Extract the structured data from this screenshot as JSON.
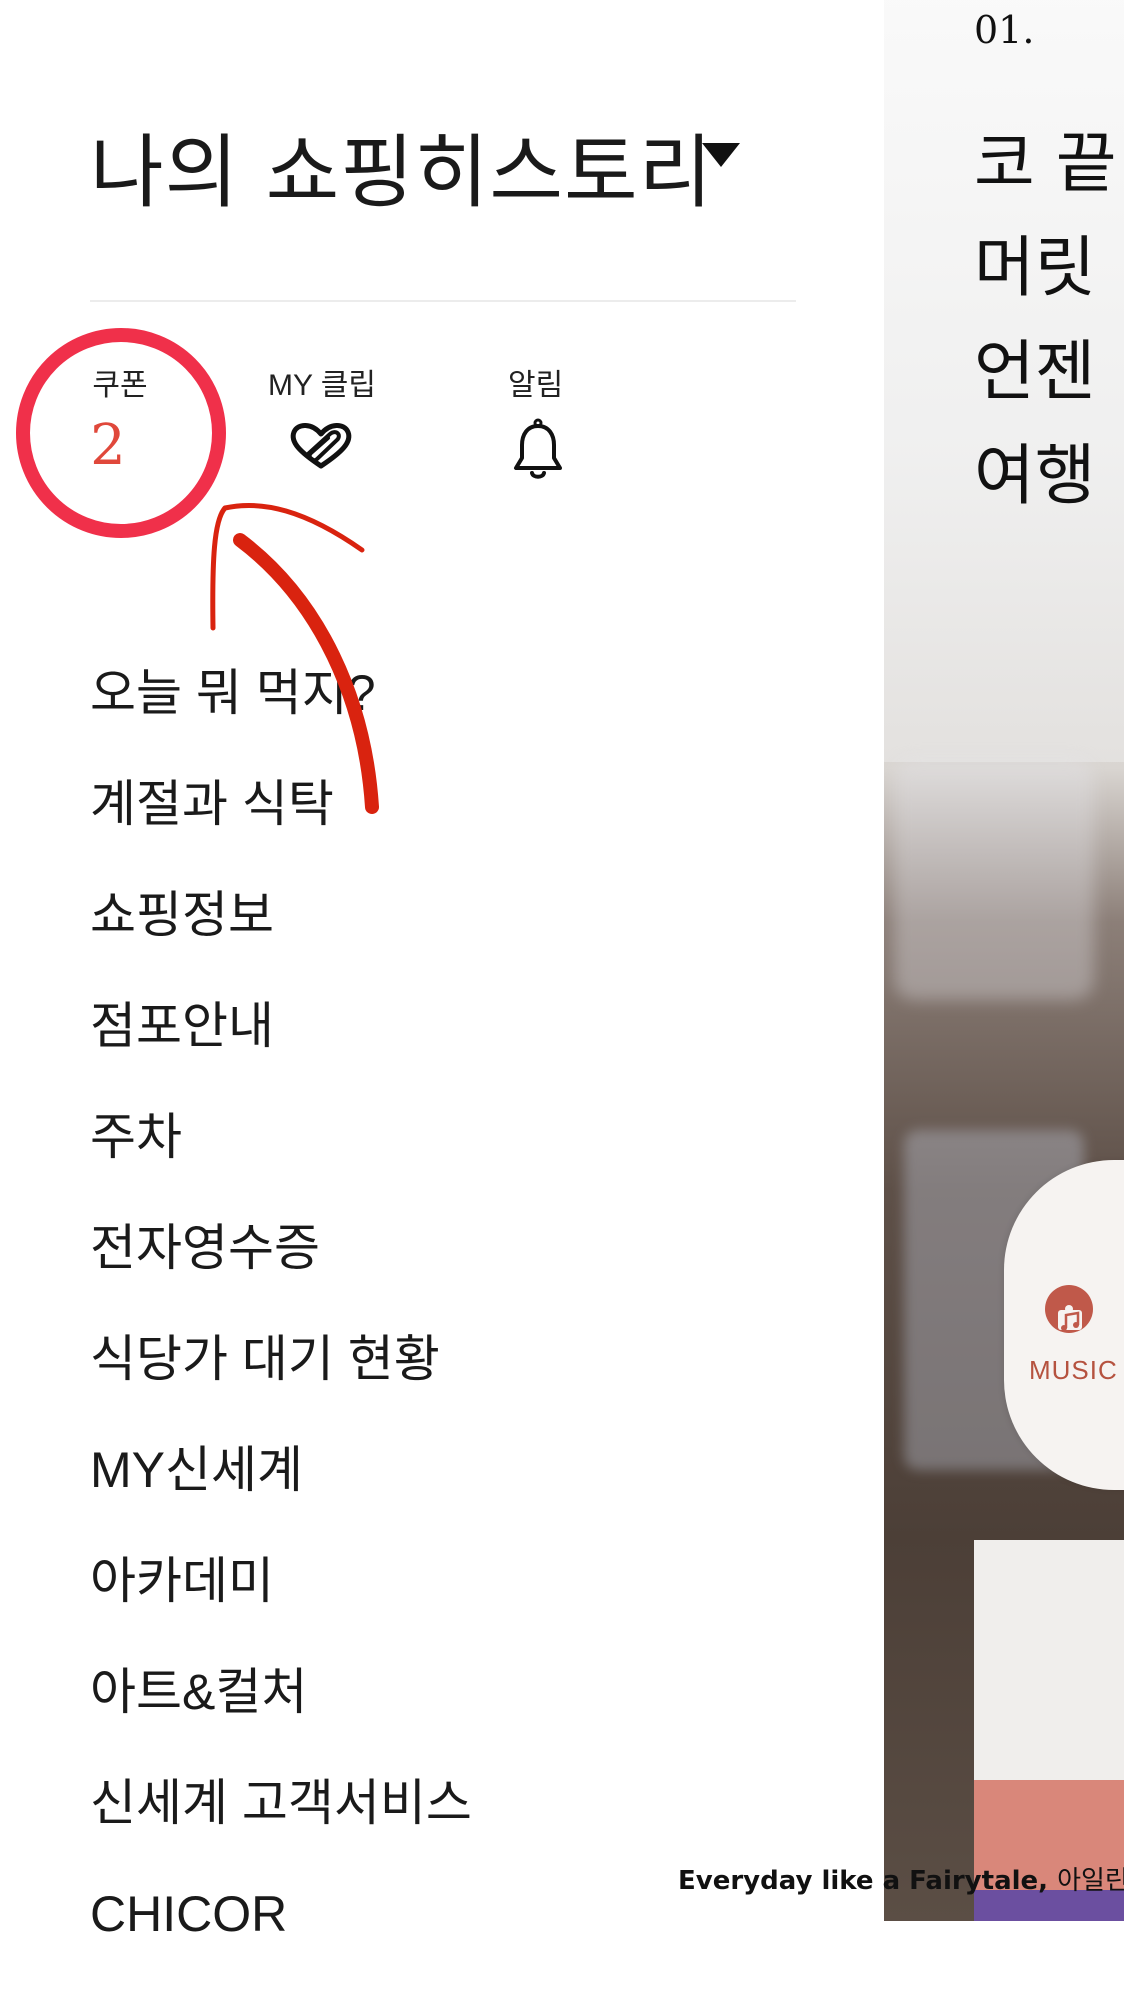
{
  "background_app": {
    "index": "01.",
    "headline_lines": [
      "코 끝",
      "머릿",
      "언젠",
      "여행"
    ],
    "music_label": "MUSIC"
  },
  "drawer": {
    "title": "나의 쇼핑히스토리",
    "title_icon": "caret-down-icon",
    "quick_links": {
      "coupon": {
        "label": "쿠폰",
        "count": "2"
      },
      "clip": {
        "label": "MY 클립",
        "icon": "heart-clip-icon"
      },
      "alarm": {
        "label": "알림",
        "icon": "bell-icon"
      }
    },
    "menu": [
      "오늘 뭐 먹지?",
      "계절과 식탁",
      "쇼핑정보",
      "점포안내",
      "주차",
      "전자영수증",
      "식당가 대기 현황",
      "MY신세계",
      "아카데미",
      "아트&컬처",
      "신세계 고객서비스",
      "CHICOR"
    ]
  },
  "watermark": {
    "text": "Everyday like a Fairytale,",
    "author": "아일린"
  },
  "colors": {
    "coupon_count": "#e0483b",
    "annotation_circle": "#f0304a",
    "annotation_arrow": "#d9230f",
    "music": "#b5523f"
  }
}
